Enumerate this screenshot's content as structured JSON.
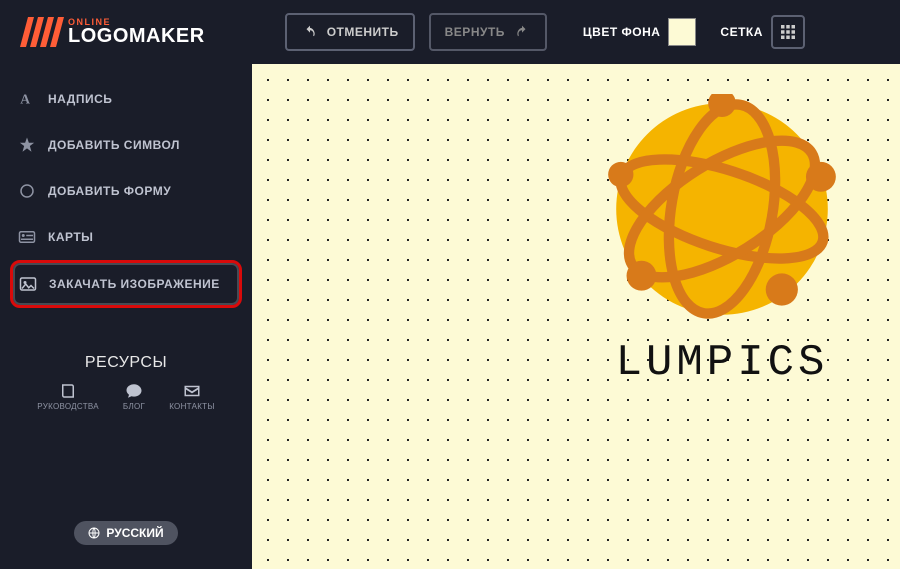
{
  "brand": {
    "small": "ONLINE",
    "big": "LOGOMAKER"
  },
  "toolbar": {
    "undo_label": "ОТМЕНИТЬ",
    "redo_label": "ВЕРНУТЬ",
    "bg_color_label": "ЦВЕТ ФОНА",
    "bg_color_value": "#fdfad5",
    "grid_label": "СЕТКА"
  },
  "sidebar": {
    "items": [
      {
        "icon": "text-icon",
        "label": "НАДПИСЬ"
      },
      {
        "icon": "star-icon",
        "label": "ДОБАВИТЬ СИМВОЛ"
      },
      {
        "icon": "circle-icon",
        "label": "ДОБАВИТЬ ФОРМУ"
      },
      {
        "icon": "card-icon",
        "label": "КАРТЫ"
      },
      {
        "icon": "image-icon",
        "label": "ЗАКАЧАТЬ ИЗОБРАЖЕНИЕ"
      }
    ]
  },
  "resources": {
    "title": "РЕСУРСЫ",
    "items": [
      {
        "icon": "book-icon",
        "label": "РУКОВОДСТВА"
      },
      {
        "icon": "comment-icon",
        "label": "БЛОГ"
      },
      {
        "icon": "mail-icon",
        "label": "КОНТАКТЫ"
      }
    ]
  },
  "language": {
    "label": "РУССКИЙ"
  },
  "canvas": {
    "logo_text": "LUMPICS",
    "globe_colors": {
      "fill": "#f5b400",
      "stroke": "#d87a1a"
    }
  }
}
